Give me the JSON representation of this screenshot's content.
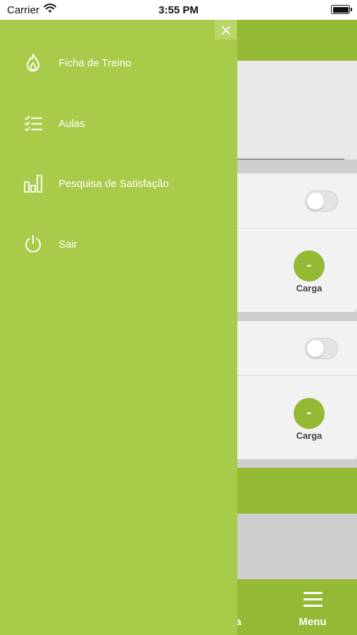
{
  "status_bar": {
    "carrier": "Carrier",
    "time": "3:55 PM",
    "wifi_icon": "wifi-icon",
    "battery_icon": "battery-icon"
  },
  "drawer": {
    "close_icon": "close-icon",
    "items": [
      {
        "label": "Ficha de Treino",
        "icon": "flame-icon"
      },
      {
        "label": "Aulas",
        "icon": "checklist-icon"
      },
      {
        "label": "Pesquisa de Satisfação",
        "icon": "bar-chart-icon"
      },
      {
        "label": "Sair",
        "icon": "power-icon"
      }
    ]
  },
  "background": {
    "cards": [
      {
        "carga_value": "-",
        "carga_label": "Carga",
        "toggle": "off"
      },
      {
        "carga_value": "-",
        "carga_label": "Carga",
        "toggle": "off"
      }
    ],
    "tabbar": {
      "partial_label": "sa",
      "menu_label": "Menu",
      "menu_icon": "hamburger-menu-icon"
    }
  },
  "colors": {
    "drawer_bg": "#a8cc4a",
    "brand_green": "#93b935",
    "text_on_green": "#ffffff"
  }
}
